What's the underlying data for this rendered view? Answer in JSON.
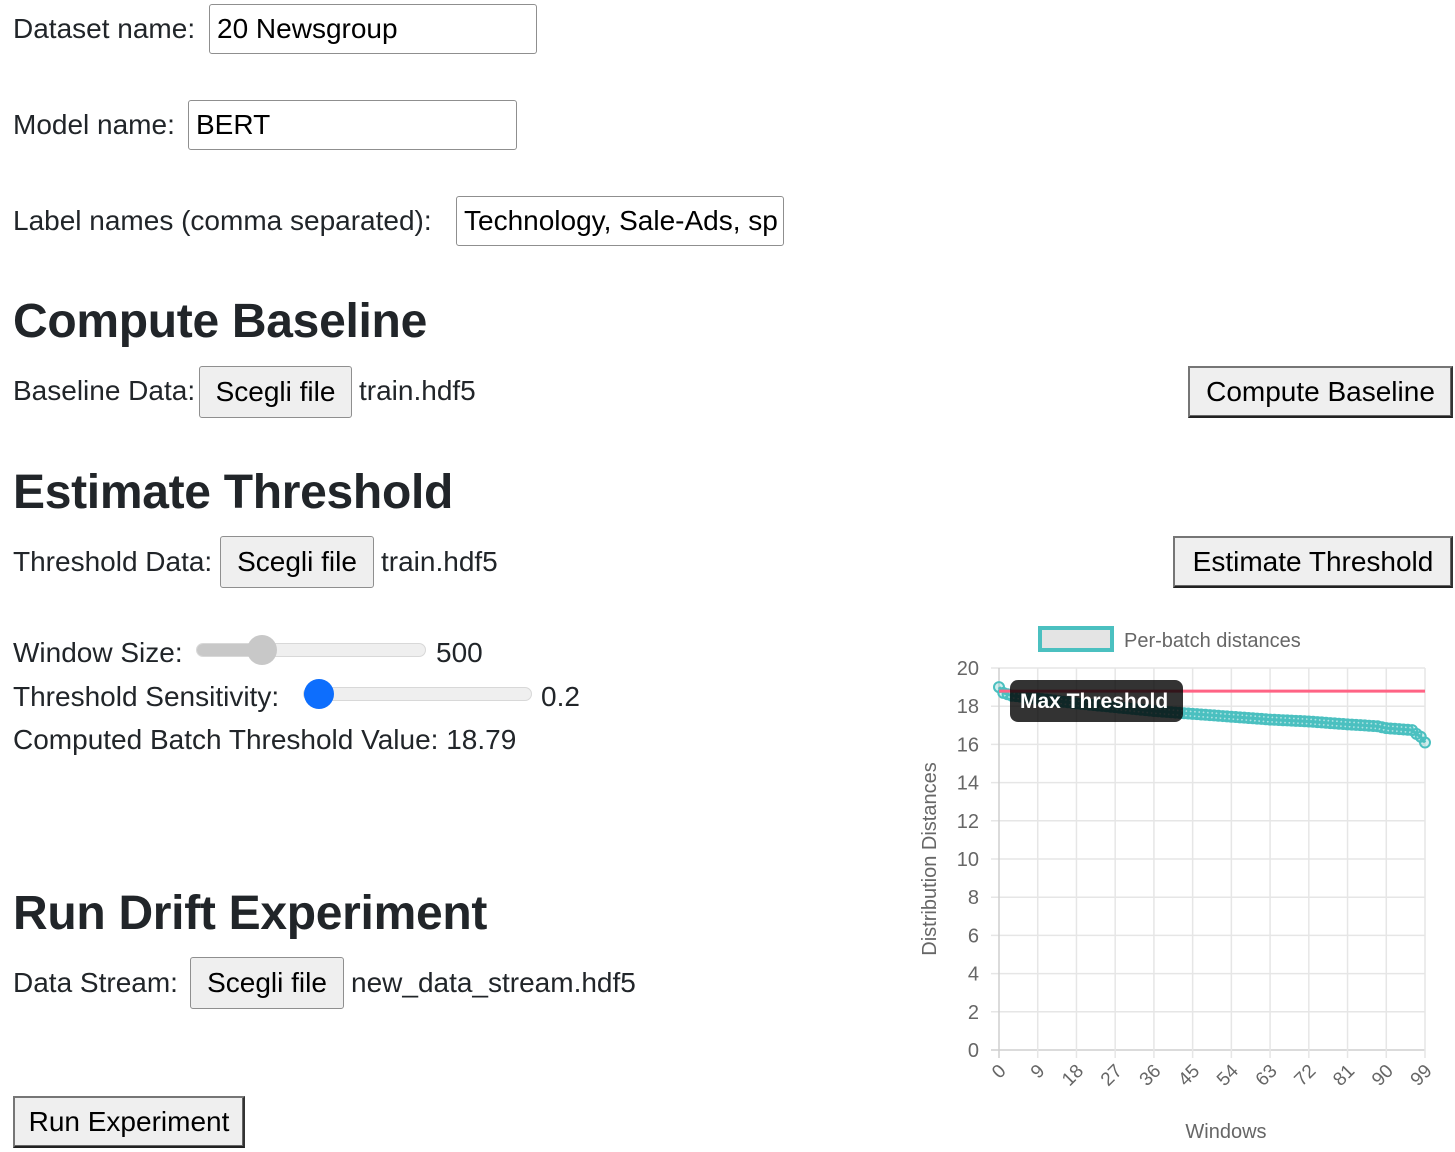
{
  "form": {
    "dataset": {
      "label": "Dataset name:",
      "value": "20 Newsgroup"
    },
    "model": {
      "label": "Model name:",
      "value": "BERT"
    },
    "labels": {
      "label": "Label names (comma separated):",
      "value": "Technology, Sale-Ads, sp"
    }
  },
  "baseline": {
    "heading": "Compute Baseline",
    "data_label": "Baseline Data:",
    "file_button": "Scegli file",
    "file_name": "train.hdf5",
    "action_button": "Compute Baseline"
  },
  "threshold": {
    "heading": "Estimate Threshold",
    "data_label": "Threshold Data:",
    "file_button": "Scegli file",
    "file_name": "train.hdf5",
    "action_button": "Estimate Threshold",
    "window_size": {
      "label": "Window Size:",
      "value_text": "500",
      "fraction": 0.25,
      "enabled": false
    },
    "sensitivity": {
      "label": "Threshold Sensitivity:",
      "value_text": "0.2",
      "fraction": 0.0,
      "enabled": true
    },
    "computed": "Computed Batch Threshold Value: 18.79"
  },
  "experiment": {
    "heading": "Run Drift Experiment",
    "data_label": "Data Stream:",
    "file_button": "Scegli file",
    "file_name": "new_data_stream.hdf5",
    "run_button": "Run Experiment"
  },
  "colors": {
    "accent": "#0d6efd",
    "series": "#4bc0c0",
    "threshold_line": "#ff6384",
    "tooltip_bg": "#000000"
  },
  "chart_data": {
    "type": "line",
    "title": "",
    "xlabel": "Windows",
    "ylabel": "Distribution Distances",
    "ylim": [
      0,
      20
    ],
    "yticks": [
      0,
      2,
      4,
      6,
      8,
      10,
      12,
      14,
      16,
      18,
      20
    ],
    "xlim": [
      0,
      99
    ],
    "xticks": [
      0,
      9,
      18,
      27,
      36,
      45,
      54,
      63,
      72,
      81,
      90,
      99
    ],
    "grid": true,
    "legend": {
      "position": "top",
      "entries": [
        "Per-batch distances"
      ]
    },
    "series": [
      {
        "name": "Per-batch distances",
        "anchors": [
          [
            0,
            19.0
          ],
          [
            1,
            18.7
          ],
          [
            3,
            18.55
          ],
          [
            9,
            18.4
          ],
          [
            18,
            18.15
          ],
          [
            27,
            17.95
          ],
          [
            36,
            17.75
          ],
          [
            45,
            17.6
          ],
          [
            54,
            17.45
          ],
          [
            63,
            17.3
          ],
          [
            72,
            17.2
          ],
          [
            81,
            17.05
          ],
          [
            88,
            16.95
          ],
          [
            90,
            16.85
          ],
          [
            96,
            16.75
          ],
          [
            97,
            16.55
          ],
          [
            98,
            16.4
          ],
          [
            99,
            16.1
          ]
        ],
        "n_points": 100
      }
    ],
    "threshold": {
      "name": "Max Threshold",
      "value": 18.79
    },
    "tooltip": "Max Threshold"
  }
}
